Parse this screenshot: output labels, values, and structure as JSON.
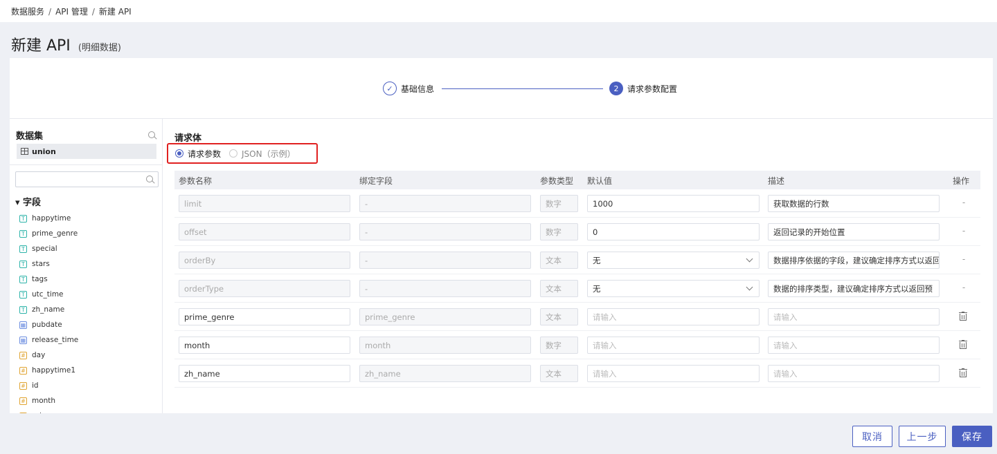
{
  "breadcrumb": [
    "数据服务",
    "API 管理",
    "新建 API"
  ],
  "page": {
    "title": "新建 API",
    "subtitle": "(明细数据)"
  },
  "steps": [
    {
      "label": "基础信息",
      "state": "done",
      "icon": "check-icon"
    },
    {
      "label": "请求参数配置",
      "state": "active",
      "number": "2"
    }
  ],
  "dataset": {
    "title": "数据集",
    "item": "union"
  },
  "fields": {
    "title": "▾ 字段",
    "items": [
      {
        "name": "happytime",
        "type": "T"
      },
      {
        "name": "prime_genre",
        "type": "T"
      },
      {
        "name": "special",
        "type": "T"
      },
      {
        "name": "stars",
        "type": "T"
      },
      {
        "name": "tags",
        "type": "T"
      },
      {
        "name": "utc_time",
        "type": "T"
      },
      {
        "name": "zh_name",
        "type": "T"
      },
      {
        "name": "pubdate",
        "type": "D"
      },
      {
        "name": "release_time",
        "type": "D"
      },
      {
        "name": "day",
        "type": "N"
      },
      {
        "name": "happytime1",
        "type": "N"
      },
      {
        "name": "id",
        "type": "N"
      },
      {
        "name": "month",
        "type": "N"
      },
      {
        "name": "price",
        "type": "N"
      }
    ]
  },
  "request": {
    "title": "请求体",
    "radio_params": "请求参数",
    "radio_json": "JSON（示例）"
  },
  "table": {
    "headers": [
      "参数名称",
      "绑定字段",
      "参数类型",
      "默认值",
      "描述",
      "操作"
    ],
    "rows": [
      {
        "name": "limit",
        "bind": "-",
        "type": "数字",
        "default": "1000",
        "desc": "获取数据的行数",
        "op": "-",
        "editable": false,
        "select": false
      },
      {
        "name": "offset",
        "bind": "-",
        "type": "数字",
        "default": "0",
        "desc": "返回记录的开始位置",
        "op": "-",
        "editable": false,
        "select": false
      },
      {
        "name": "orderBy",
        "bind": "-",
        "type": "文本",
        "default": "无",
        "desc": "数据排序依据的字段，建议确定排序方式以返回",
        "op": "-",
        "editable": false,
        "select": true
      },
      {
        "name": "orderType",
        "bind": "-",
        "type": "文本",
        "default": "无",
        "desc": "数据的排序类型，建议确定排序方式以返回预",
        "op": "-",
        "editable": false,
        "select": true
      },
      {
        "name": "prime_genre",
        "bind": "prime_genre",
        "type": "文本",
        "default": "",
        "desc": "",
        "op": "trash",
        "editable": true,
        "select": false
      },
      {
        "name": "month",
        "bind": "month",
        "type": "数字",
        "default": "",
        "desc": "",
        "op": "trash",
        "editable": true,
        "select": false
      },
      {
        "name": "zh_name",
        "bind": "zh_name",
        "type": "文本",
        "default": "",
        "desc": "",
        "op": "trash",
        "editable": true,
        "select": false
      }
    ],
    "placeholder": "请输入"
  },
  "buttons": {
    "cancel": "取消",
    "prev": "上一步",
    "save": "保存"
  },
  "colors": {
    "primary": "#4a5fc1",
    "highlight": "#e02020"
  }
}
